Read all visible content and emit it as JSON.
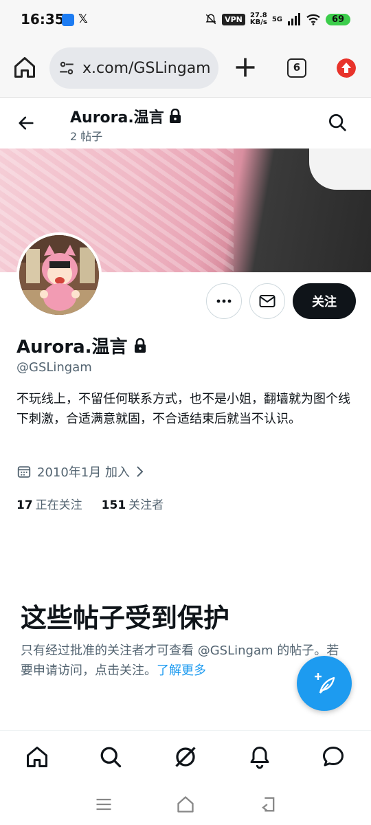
{
  "status_bar": {
    "time": "16:35",
    "app_icon_1": "notification-app-icon",
    "app_icon_2": "𝕏",
    "vpn": "VPN",
    "net_speed_value": "27.8",
    "net_speed_unit": "KB/s",
    "network": "5G",
    "battery": "69"
  },
  "browser": {
    "url": "x.com/GSLingam",
    "tab_count": "6"
  },
  "header": {
    "name": "Aurora.温言",
    "post_count": "2 帖子"
  },
  "actions": {
    "follow_label": "关注"
  },
  "profile": {
    "name": "Aurora.温言",
    "handle": "@GSLingam",
    "bio": "不玩线上，不留任何联系方式，也不是小姐，翻墙就为图个线下刺激，合适满意就固，不合适结束后就当不认识。",
    "joined": "2010年1月 加入",
    "following_count": "17",
    "following_label": "正在关注",
    "followers_count": "151",
    "followers_label": "关注者"
  },
  "protected": {
    "title": "这些帖子受到保护",
    "description": "只有经过批准的关注者才可查看 @GSLingam 的帖子。若要申请访问，点击关注。",
    "link": "了解更多"
  },
  "colors": {
    "accent": "#1d9bf0",
    "text_primary": "#0f1419",
    "text_secondary": "#536471",
    "follow_button": "#0f1419",
    "battery": "#3ccd4b"
  },
  "icons": {
    "bottom_nav": [
      "home-icon",
      "search-icon",
      "grok-icon",
      "notifications-icon",
      "messages-icon"
    ],
    "system_nav": [
      "menu-icon",
      "home-icon",
      "back-icon"
    ]
  }
}
